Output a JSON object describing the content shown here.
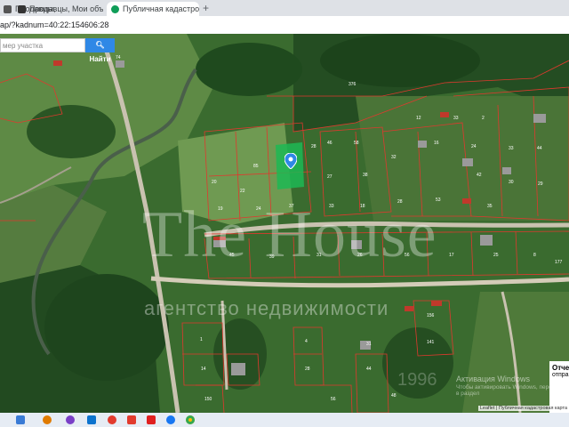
{
  "browser": {
    "tabs": [
      {
        "label": "Продавцы, Мои объекты",
        "icon": "doc-icon",
        "color": "#555555"
      },
      {
        "label": "Продавцы, Мои объекты",
        "icon": "doc-icon",
        "color": "#333333"
      },
      {
        "label": "Публичная кадастровая карта",
        "icon": "map-pin-icon",
        "color": "#0f9d58",
        "active": true
      }
    ],
    "new_tab": "+",
    "url": "ap/?kadnum=40:22:154606:28"
  },
  "map": {
    "search_placeholder": "мер участка",
    "search_button": "Найти",
    "watermark_title": "The House",
    "watermark_subtitle": "агентство недвижимости",
    "watermark_year": "1996",
    "activation_title": "Активация Windows",
    "activation_text": "Чтобы активировать Windows, перейдите в раздел",
    "side_title": "Отче",
    "side_text": "отпра",
    "attribution": "Leaflet | Публичная кадастровая карта",
    "parcel_labels": [
      "376",
      "28",
      "85",
      "20",
      "22",
      "19",
      "24",
      "37",
      "33",
      "18",
      "28",
      "53",
      "35",
      "38",
      "27",
      "32",
      "46",
      "58",
      "16",
      "24",
      "33",
      "44",
      "42",
      "30",
      "29",
      "45",
      "39",
      "31",
      "177",
      "26",
      "56",
      "17",
      "25",
      "8",
      "12",
      "33",
      "2",
      "1",
      "14",
      "4",
      "28",
      "31",
      "44",
      "150",
      "156",
      "141",
      "56",
      "74",
      "48"
    ]
  },
  "taskbar": {
    "icons": [
      "windows-icon",
      "search-icon",
      "task-view-icon",
      "chrome-icon"
    ]
  },
  "colors": {
    "accent": "#2f88e6",
    "parcel_outline": "#e0392e",
    "selected_parcel": "#1db954"
  }
}
